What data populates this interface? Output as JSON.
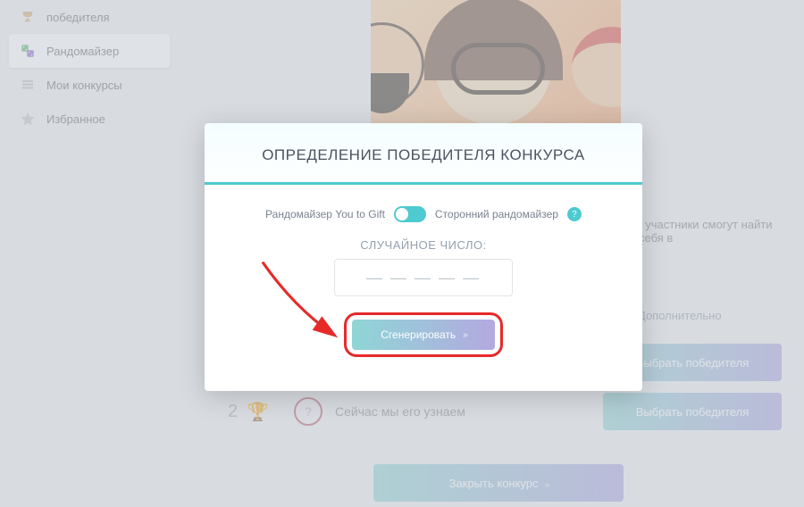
{
  "sidebar": {
    "items": [
      {
        "label": "победителя",
        "icon": "trophy-icon"
      },
      {
        "label": "Рандомайзер",
        "icon": "dice-icon",
        "active": true
      },
      {
        "label": "Мои конкурсы",
        "icon": "list-icon"
      },
      {
        "label": "Избранное",
        "icon": "star-icon"
      }
    ]
  },
  "main": {
    "hint_text": ", участники смогут найти себя в",
    "extra_link": "Дополнительно",
    "select_winner_label": "Выбрать победителя",
    "close_contest_label": "Закрыть конкурс",
    "row2": {
      "number": "2",
      "text": "Сейчас мы его узнаем"
    }
  },
  "modal": {
    "title": "ОПРЕДЕЛЕНИЕ ПОБЕДИТЕЛЯ КОНКУРСА",
    "option_internal": "Рандомайзер You to Gift",
    "option_external": "Сторонний рандомайзер",
    "random_number_label": "СЛУЧАЙНОЕ ЧИСЛО:",
    "digits_placeholder": "— — — — —",
    "generate_label": "Сгенерировать",
    "help_symbol": "?"
  },
  "colors": {
    "accent": "#4ecad1",
    "annotation_red": "#e62a2a",
    "gradient_start": "#8ed6d6",
    "gradient_end": "#b4a9e0"
  }
}
